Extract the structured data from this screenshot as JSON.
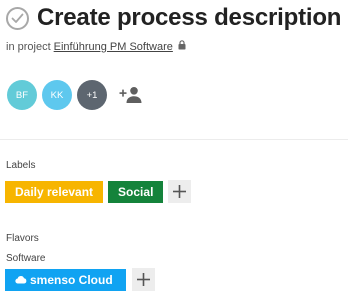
{
  "header": {
    "title": "Create process description",
    "project_prefix": "in project",
    "project_name": "Einführung PM Software"
  },
  "avatars": [
    {
      "initials": "BF",
      "color": "#62cbd8"
    },
    {
      "initials": "KK",
      "color": "#5ec8ee"
    },
    {
      "initials": "+1",
      "color": "#5d6670"
    }
  ],
  "labels_section": {
    "heading": "Labels",
    "items": [
      {
        "text": "Daily relevant",
        "color": "#f7b500"
      },
      {
        "text": "Social",
        "color": "#14833b"
      }
    ]
  },
  "flavors_section": {
    "heading": "Flavors",
    "software_heading": "Software",
    "software_item": {
      "text": "smenso Cloud",
      "color": "#10a3f2",
      "icon": "cloud-icon"
    }
  },
  "icons": {
    "complete": "check-circle-icon",
    "lock": "lock-icon",
    "add_user": "add-person-icon",
    "add": "plus-icon"
  }
}
